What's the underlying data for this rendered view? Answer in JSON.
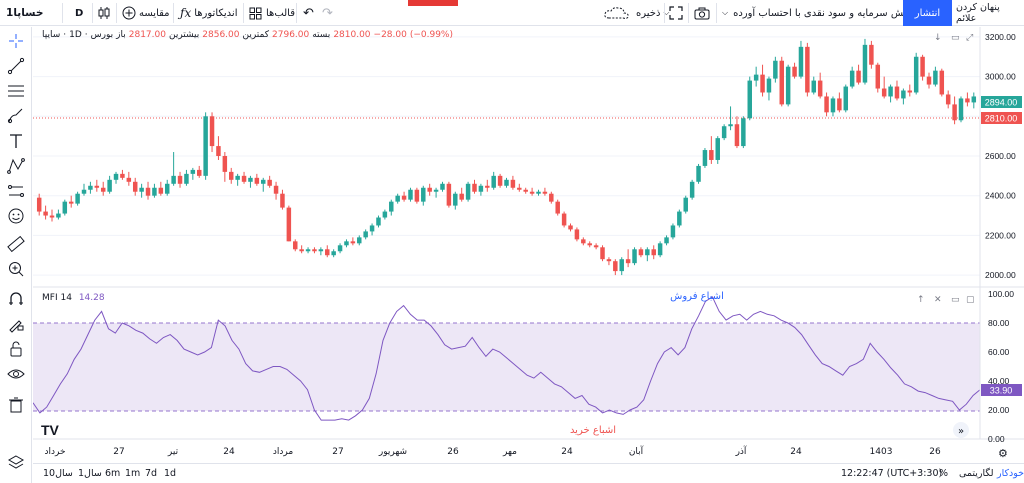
{
  "topbar": {
    "hide_alerts": "پنهان کردن علائم",
    "publish": "انتشار",
    "notice": "افزایش سرمایه و سود نقدی با احتساب آورده",
    "save": "ذخیره",
    "compare": "مقایسه",
    "indicators": "اندیکاتورها",
    "templates": "قالب‌ها",
    "interval": "D",
    "symbol": "خساپا1"
  },
  "legend": {
    "symbol": "سایپا",
    "interval": "1D",
    "exchange": "بورس",
    "open_label": "باز",
    "open": "2817.00",
    "high_label": "بیشترین",
    "high": "2856.00",
    "low_label": "کمترین",
    "low": "2796.00",
    "close_label": "بسته",
    "close": "2810.00",
    "change": "−28.00",
    "change_pct": "(−0.99%)"
  },
  "price_axis": {
    "ticks": [
      "3200.00",
      "3000.00",
      "2800.00",
      "2600.00",
      "2400.00",
      "2200.00",
      "2000.00"
    ],
    "current_price": "2894.00",
    "close_price": "2810.00"
  },
  "mfi": {
    "name": "MFI",
    "length": "14",
    "value": "14.28",
    "ticks": [
      "100.00",
      "80.00",
      "60.00",
      "40.00",
      "20.00",
      "0.00"
    ],
    "current": "33.90",
    "overbought_label": "اشباع فروش",
    "oversold_label": "اشباع خرید"
  },
  "time_axis": {
    "labels": [
      "خرداد",
      "27",
      "تیر",
      "24",
      "مرداد",
      "27",
      "شهریور",
      "26",
      "مهر",
      "24",
      "آبان",
      "آذر",
      "24",
      "1403",
      "26"
    ]
  },
  "bottombar": {
    "ranges": [
      "10سال",
      "1سال",
      "6m",
      "1m",
      "7d",
      "1d"
    ],
    "clock": "12:22:47 (UTC+3:30)",
    "percent": "%",
    "log": "لگاریتمی",
    "auto": "خودکار"
  },
  "colors": {
    "up": "#26a69a",
    "down": "#ef5350",
    "accent": "#2962ff",
    "mfi_line": "#7e57c2",
    "mfi_band": "#ede7f6"
  },
  "chart_data": {
    "type": "candlestick",
    "ohlc": [
      [
        2390,
        2410,
        2300,
        2320
      ],
      [
        2320,
        2350,
        2280,
        2300
      ],
      [
        2300,
        2330,
        2270,
        2290
      ],
      [
        2290,
        2330,
        2280,
        2310
      ],
      [
        2310,
        2380,
        2300,
        2370
      ],
      [
        2370,
        2400,
        2340,
        2360
      ],
      [
        2360,
        2420,
        2350,
        2410
      ],
      [
        2410,
        2460,
        2400,
        2430
      ],
      [
        2430,
        2470,
        2410,
        2450
      ],
      [
        2450,
        2480,
        2420,
        2440
      ],
      [
        2440,
        2470,
        2400,
        2420
      ],
      [
        2420,
        2500,
        2410,
        2480
      ],
      [
        2480,
        2520,
        2460,
        2510
      ],
      [
        2510,
        2530,
        2480,
        2490
      ],
      [
        2490,
        2520,
        2450,
        2470
      ],
      [
        2470,
        2490,
        2400,
        2420
      ],
      [
        2420,
        2460,
        2390,
        2440
      ],
      [
        2440,
        2470,
        2380,
        2400
      ],
      [
        2400,
        2460,
        2390,
        2440
      ],
      [
        2440,
        2470,
        2400,
        2410
      ],
      [
        2410,
        2480,
        2400,
        2460
      ],
      [
        2460,
        2620,
        2450,
        2500
      ],
      [
        2500,
        2520,
        2440,
        2460
      ],
      [
        2460,
        2530,
        2450,
        2510
      ],
      [
        2510,
        2540,
        2480,
        2530
      ],
      [
        2530,
        2550,
        2490,
        2500
      ],
      [
        2500,
        2820,
        2480,
        2800
      ],
      [
        2800,
        2820,
        2620,
        2650
      ],
      [
        2650,
        2700,
        2580,
        2600
      ],
      [
        2600,
        2620,
        2470,
        2520
      ],
      [
        2520,
        2540,
        2460,
        2480
      ],
      [
        2480,
        2510,
        2450,
        2500
      ],
      [
        2500,
        2520,
        2460,
        2470
      ],
      [
        2470,
        2500,
        2440,
        2490
      ],
      [
        2490,
        2510,
        2450,
        2460
      ],
      [
        2460,
        2490,
        2420,
        2480
      ],
      [
        2480,
        2500,
        2440,
        2450
      ],
      [
        2450,
        2470,
        2380,
        2410
      ],
      [
        2410,
        2430,
        2330,
        2340
      ],
      [
        2340,
        2350,
        2170,
        2170
      ],
      [
        2170,
        2180,
        2120,
        2130
      ],
      [
        2130,
        2150,
        2110,
        2120
      ],
      [
        2120,
        2140,
        2110,
        2130
      ],
      [
        2130,
        2140,
        2110,
        2120
      ],
      [
        2120,
        2140,
        2100,
        2130
      ],
      [
        2130,
        2150,
        2090,
        2100
      ],
      [
        2100,
        2130,
        2090,
        2120
      ],
      [
        2120,
        2160,
        2110,
        2150
      ],
      [
        2150,
        2180,
        2140,
        2170
      ],
      [
        2170,
        2190,
        2150,
        2160
      ],
      [
        2160,
        2200,
        2150,
        2190
      ],
      [
        2190,
        2230,
        2180,
        2220
      ],
      [
        2220,
        2260,
        2200,
        2250
      ],
      [
        2250,
        2300,
        2240,
        2290
      ],
      [
        2290,
        2330,
        2280,
        2320
      ],
      [
        2320,
        2380,
        2300,
        2370
      ],
      [
        2370,
        2410,
        2360,
        2400
      ],
      [
        2400,
        2420,
        2370,
        2380
      ],
      [
        2380,
        2440,
        2370,
        2430
      ],
      [
        2430,
        2440,
        2360,
        2370
      ],
      [
        2370,
        2450,
        2350,
        2440
      ],
      [
        2440,
        2460,
        2400,
        2420
      ],
      [
        2420,
        2440,
        2390,
        2430
      ],
      [
        2430,
        2470,
        2420,
        2460
      ],
      [
        2460,
        2470,
        2340,
        2350
      ],
      [
        2350,
        2420,
        2330,
        2410
      ],
      [
        2410,
        2440,
        2370,
        2380
      ],
      [
        2380,
        2470,
        2370,
        2460
      ],
      [
        2460,
        2480,
        2410,
        2420
      ],
      [
        2420,
        2460,
        2400,
        2450
      ],
      [
        2450,
        2480,
        2420,
        2440
      ],
      [
        2440,
        2520,
        2430,
        2500
      ],
      [
        2500,
        2510,
        2440,
        2450
      ],
      [
        2450,
        2490,
        2440,
        2480
      ],
      [
        2480,
        2500,
        2430,
        2440
      ],
      [
        2440,
        2460,
        2420,
        2430
      ],
      [
        2430,
        2440,
        2410,
        2420
      ],
      [
        2420,
        2440,
        2400,
        2410
      ],
      [
        2410,
        2430,
        2400,
        2420
      ],
      [
        2420,
        2440,
        2400,
        2410
      ],
      [
        2410,
        2420,
        2360,
        2370
      ],
      [
        2370,
        2380,
        2300,
        2310
      ],
      [
        2310,
        2320,
        2240,
        2250
      ],
      [
        2250,
        2260,
        2220,
        2230
      ],
      [
        2230,
        2240,
        2170,
        2180
      ],
      [
        2180,
        2190,
        2150,
        2160
      ],
      [
        2160,
        2170,
        2140,
        2150
      ],
      [
        2150,
        2160,
        2130,
        2140
      ],
      [
        2140,
        2150,
        2070,
        2080
      ],
      [
        2080,
        2090,
        2050,
        2070
      ],
      [
        2070,
        2080,
        2000,
        2020
      ],
      [
        2020,
        2090,
        2000,
        2080
      ],
      [
        2080,
        2130,
        2040,
        2060
      ],
      [
        2060,
        2140,
        2050,
        2130
      ],
      [
        2130,
        2140,
        2090,
        2100
      ],
      [
        2100,
        2140,
        2070,
        2130
      ],
      [
        2130,
        2150,
        2080,
        2100
      ],
      [
        2100,
        2170,
        2090,
        2160
      ],
      [
        2160,
        2200,
        2150,
        2190
      ],
      [
        2190,
        2260,
        2180,
        2250
      ],
      [
        2250,
        2330,
        2240,
        2320
      ],
      [
        2320,
        2400,
        2310,
        2390
      ],
      [
        2390,
        2480,
        2380,
        2470
      ],
      [
        2470,
        2560,
        2460,
        2550
      ],
      [
        2550,
        2640,
        2540,
        2630
      ],
      [
        2630,
        2700,
        2560,
        2580
      ],
      [
        2580,
        2700,
        2560,
        2690
      ],
      [
        2690,
        2760,
        2680,
        2750
      ],
      [
        2750,
        2850,
        2730,
        2760
      ],
      [
        2760,
        2800,
        2640,
        2650
      ],
      [
        2650,
        2800,
        2640,
        2790
      ],
      [
        2790,
        3000,
        2780,
        2980
      ],
      [
        2980,
        3050,
        2950,
        3010
      ],
      [
        3010,
        3060,
        2900,
        2920
      ],
      [
        2920,
        3000,
        2880,
        2990
      ],
      [
        2990,
        3100,
        2970,
        3080
      ],
      [
        3080,
        3100,
        2850,
        2860
      ],
      [
        2860,
        3060,
        2850,
        3050
      ],
      [
        3050,
        3070,
        2990,
        3000
      ],
      [
        3000,
        3180,
        2990,
        3150
      ],
      [
        3150,
        3170,
        2900,
        2920
      ],
      [
        2920,
        3000,
        2910,
        2980
      ],
      [
        2980,
        3020,
        2890,
        2900
      ],
      [
        2900,
        2920,
        2800,
        2820
      ],
      [
        2820,
        2900,
        2800,
        2890
      ],
      [
        2890,
        2920,
        2820,
        2830
      ],
      [
        2830,
        2960,
        2820,
        2950
      ],
      [
        2950,
        3050,
        2940,
        3030
      ],
      [
        3030,
        3060,
        2960,
        2970
      ],
      [
        2970,
        3190,
        2960,
        3160
      ],
      [
        3160,
        3180,
        3040,
        3060
      ],
      [
        3060,
        3070,
        2920,
        2940
      ],
      [
        2940,
        3000,
        2890,
        2900
      ],
      [
        2900,
        2960,
        2870,
        2950
      ],
      [
        2950,
        2980,
        2880,
        2890
      ],
      [
        2890,
        2940,
        2860,
        2930
      ],
      [
        2930,
        2960,
        2900,
        2920
      ],
      [
        2920,
        3120,
        2910,
        3100
      ],
      [
        3100,
        3110,
        2980,
        3000
      ],
      [
        3000,
        3020,
        2940,
        2960
      ],
      [
        2960,
        3050,
        2950,
        3030
      ],
      [
        3030,
        3040,
        2900,
        2910
      ],
      [
        2910,
        2930,
        2840,
        2860
      ],
      [
        2860,
        2900,
        2760,
        2780
      ],
      [
        2780,
        2900,
        2770,
        2890
      ],
      [
        2890,
        2920,
        2850,
        2870
      ],
      [
        2870,
        2920,
        2840,
        2900
      ]
    ],
    "mfi_values": [
      25,
      18,
      22,
      30,
      38,
      45,
      55,
      62,
      72,
      82,
      88,
      76,
      73,
      80,
      78,
      75,
      73,
      69,
      66,
      70,
      72,
      68,
      62,
      60,
      58,
      60,
      63,
      82,
      78,
      68,
      62,
      52,
      47,
      46,
      48,
      50,
      50,
      48,
      44,
      40,
      34,
      20,
      13,
      13,
      13,
      14,
      13,
      16,
      20,
      28,
      45,
      68,
      80,
      88,
      92,
      86,
      82,
      82,
      78,
      72,
      65,
      62,
      63,
      64,
      70,
      63,
      57,
      62,
      60,
      56,
      52,
      48,
      44,
      42,
      46,
      42,
      38,
      36,
      32,
      28,
      30,
      24,
      22,
      18,
      20,
      18,
      17,
      20,
      22,
      27,
      40,
      52,
      60,
      63,
      58,
      63,
      76,
      85,
      95,
      98,
      88,
      82,
      85,
      86,
      82,
      86,
      88,
      86,
      85,
      82,
      80,
      77,
      72,
      65,
      58,
      52,
      50,
      47,
      44,
      50,
      52,
      55,
      66,
      60,
      55,
      49,
      44,
      38,
      36,
      33,
      32,
      30,
      28,
      27,
      26,
      20,
      24,
      30,
      34
    ],
    "ylim": [
      1950,
      3250
    ],
    "mfi_ylim": [
      0,
      100
    ]
  }
}
